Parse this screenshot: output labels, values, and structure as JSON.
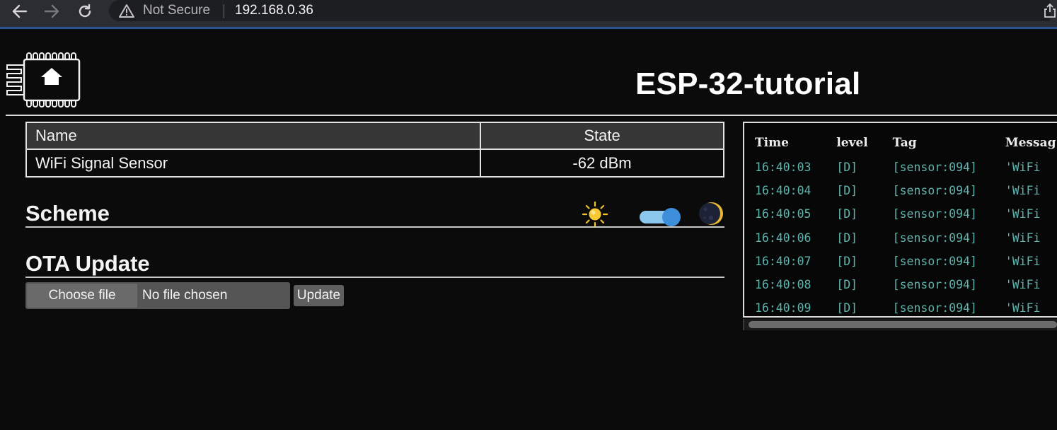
{
  "browser": {
    "back_icon": "arrow-left-icon",
    "forward_icon": "arrow-right-icon",
    "reload_icon": "reload-icon",
    "security_label": "Not Secure",
    "url": "192.168.0.36",
    "accent_color": "#2d5596"
  },
  "header": {
    "logo_icon": "home-chip-icon",
    "title": "ESP-32-tutorial"
  },
  "entities": {
    "columns": [
      "Name",
      "State"
    ],
    "rows": [
      {
        "name": "WiFi Signal Sensor",
        "state": "-62 dBm"
      }
    ]
  },
  "scheme": {
    "title": "Scheme",
    "light_icon": "sun-icon",
    "dark_icon": "moon-icon",
    "dark_mode_enabled": true,
    "toggle_color": "#3d8fdc"
  },
  "ota": {
    "title": "OTA Update",
    "choose_label": "Choose file",
    "file_status": "No file chosen",
    "update_label": "Update"
  },
  "log": {
    "columns": [
      "Time",
      "level",
      "Tag",
      "Messag"
    ],
    "rows": [
      {
        "time": "16:40:03",
        "level": "[D]",
        "tag": "[sensor:094]",
        "message": "'WiFi"
      },
      {
        "time": "16:40:04",
        "level": "[D]",
        "tag": "[sensor:094]",
        "message": "'WiFi"
      },
      {
        "time": "16:40:05",
        "level": "[D]",
        "tag": "[sensor:094]",
        "message": "'WiFi"
      },
      {
        "time": "16:40:06",
        "level": "[D]",
        "tag": "[sensor:094]",
        "message": "'WiFi"
      },
      {
        "time": "16:40:07",
        "level": "[D]",
        "tag": "[sensor:094]",
        "message": "'WiFi"
      },
      {
        "time": "16:40:08",
        "level": "[D]",
        "tag": "[sensor:094]",
        "message": "'WiFi"
      },
      {
        "time": "16:40:09",
        "level": "[D]",
        "tag": "[sensor:094]",
        "message": "'WiFi"
      }
    ],
    "text_color": "#5fb3ad"
  }
}
